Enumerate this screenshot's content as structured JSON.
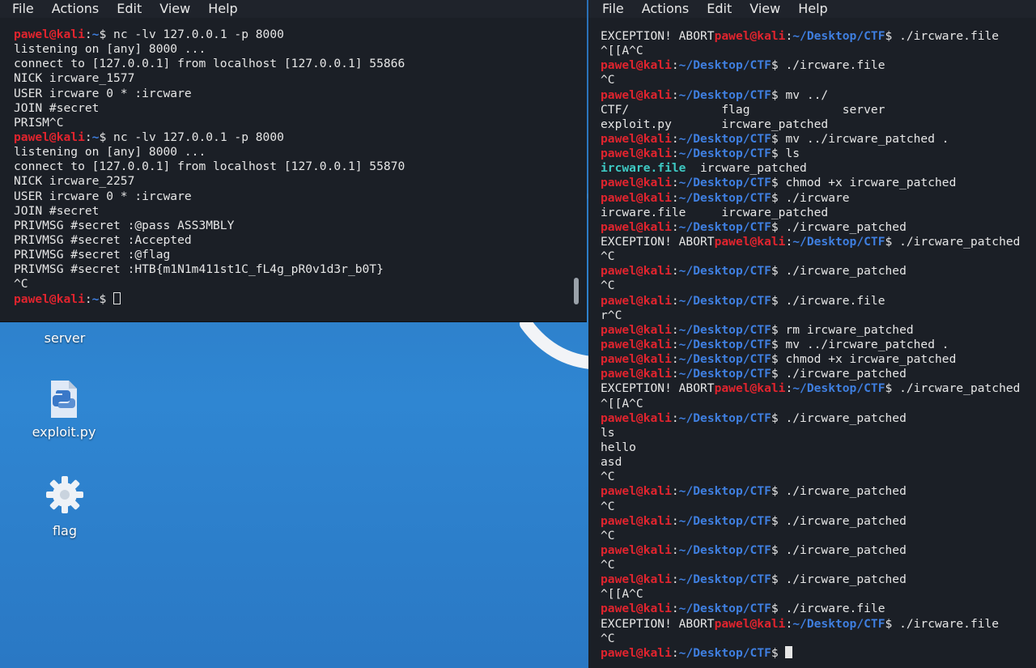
{
  "menu": [
    "File",
    "Actions",
    "Edit",
    "View",
    "Help"
  ],
  "prompt": {
    "user": "pawel@kali",
    "sep": ":",
    "path_home": "~",
    "path_ctf": "~/Desktop/CTF",
    "dollar": "$ "
  },
  "left_terminal": {
    "lines": [
      {
        "type": "home_prompt",
        "cmd": "nc -lv 127.0.0.1 -p 8000"
      },
      {
        "type": "out",
        "text": "listening on [any] 8000 ..."
      },
      {
        "type": "out",
        "text": "connect to [127.0.0.1] from localhost [127.0.0.1] 55866"
      },
      {
        "type": "out",
        "text": "NICK ircware_1577"
      },
      {
        "type": "out",
        "text": "USER ircware 0 * :ircware"
      },
      {
        "type": "out",
        "text": "JOIN #secret"
      },
      {
        "type": "out",
        "text": "PRISM^C"
      },
      {
        "type": "home_prompt",
        "cmd": "nc -lv 127.0.0.1 -p 8000"
      },
      {
        "type": "out",
        "text": "listening on [any] 8000 ..."
      },
      {
        "type": "out",
        "text": "connect to [127.0.0.1] from localhost [127.0.0.1] 55870"
      },
      {
        "type": "out",
        "text": "NICK ircware_2257"
      },
      {
        "type": "out",
        "text": "USER ircware 0 * :ircware"
      },
      {
        "type": "out",
        "text": "JOIN #secret"
      },
      {
        "type": "out",
        "text": "PRIVMSG #secret :@pass ASS3MBLY"
      },
      {
        "type": "out",
        "text": "PRIVMSG #secret :Accepted"
      },
      {
        "type": "out",
        "text": "PRIVMSG #secret :@flag"
      },
      {
        "type": "out",
        "text": "PRIVMSG #secret :HTB{m1N1m411st1C_fL4g_pR0v1d3r_b0T}"
      },
      {
        "type": "out",
        "text": "^C"
      },
      {
        "type": "home_prompt",
        "cmd": "",
        "cursor": "outline"
      }
    ]
  },
  "right_terminal": {
    "lines": [
      {
        "type": "exc_prompt",
        "pre": "EXCEPTION! ABORT",
        "cmd": "./ircware.file"
      },
      {
        "type": "out",
        "text": "^[[A^C"
      },
      {
        "type": "prompt",
        "cmd": "./ircware.file"
      },
      {
        "type": "out",
        "text": "^C"
      },
      {
        "type": "prompt",
        "cmd": "mv ../"
      },
      {
        "type": "out",
        "text": "CTF/             flag             server"
      },
      {
        "type": "out",
        "text": "exploit.py       ircware_patched"
      },
      {
        "type": "prompt",
        "cmd": "mv ../ircware_patched ."
      },
      {
        "type": "prompt",
        "cmd": "ls"
      },
      {
        "type": "ls",
        "hl": "ircware.file",
        "rest": "  ircware_patched"
      },
      {
        "type": "prompt",
        "cmd": "chmod +x ircware_patched"
      },
      {
        "type": "prompt",
        "cmd": "./ircware"
      },
      {
        "type": "out",
        "text": "ircware.file     ircware_patched"
      },
      {
        "type": "prompt",
        "cmd": "./ircware_patched"
      },
      {
        "type": "exc_prompt",
        "pre": "EXCEPTION! ABORT",
        "cmd": "./ircware_patched"
      },
      {
        "type": "out",
        "text": "^C"
      },
      {
        "type": "prompt",
        "cmd": "./ircware_patched"
      },
      {
        "type": "out",
        "text": "^C"
      },
      {
        "type": "prompt",
        "cmd": "./ircware.file"
      },
      {
        "type": "out",
        "text": "r^C"
      },
      {
        "type": "prompt",
        "cmd": "rm ircware_patched"
      },
      {
        "type": "prompt",
        "cmd": "mv ../ircware_patched ."
      },
      {
        "type": "prompt",
        "cmd": "chmod +x ircware_patched"
      },
      {
        "type": "prompt",
        "cmd": "./ircware_patched"
      },
      {
        "type": "exc_prompt",
        "pre": "EXCEPTION! ABORT",
        "cmd": "./ircware_patched"
      },
      {
        "type": "out",
        "text": "^[[A^C"
      },
      {
        "type": "prompt",
        "cmd": "./ircware_patched"
      },
      {
        "type": "out",
        "text": "ls"
      },
      {
        "type": "out",
        "text": "hello"
      },
      {
        "type": "out",
        "text": "asd"
      },
      {
        "type": "out",
        "text": "^C"
      },
      {
        "type": "prompt",
        "cmd": "./ircware_patched"
      },
      {
        "type": "out",
        "text": "^C"
      },
      {
        "type": "prompt",
        "cmd": "./ircware_patched"
      },
      {
        "type": "out",
        "text": "^C"
      },
      {
        "type": "prompt",
        "cmd": "./ircware_patched"
      },
      {
        "type": "out",
        "text": "^C"
      },
      {
        "type": "prompt",
        "cmd": "./ircware_patched"
      },
      {
        "type": "out",
        "text": "^[[A^C"
      },
      {
        "type": "prompt",
        "cmd": "./ircware.file"
      },
      {
        "type": "exc_prompt",
        "pre": "EXCEPTION! ABORT",
        "cmd": "./ircware.file"
      },
      {
        "type": "out",
        "text": "^C"
      },
      {
        "type": "prompt",
        "cmd": "",
        "cursor": "block"
      }
    ]
  },
  "desktop": {
    "icons": [
      {
        "name": "server",
        "label": "server",
        "icon": "folder-icon"
      },
      {
        "name": "exploit",
        "label": "exploit.py",
        "icon": "python-file-icon"
      },
      {
        "name": "flag",
        "label": "flag",
        "icon": "gear-icon"
      }
    ]
  },
  "colors": {
    "user": "#e0242e",
    "path": "#3f7fe0",
    "terminal_bg": "#1b1f26",
    "highlight": "#3ec9c3"
  }
}
